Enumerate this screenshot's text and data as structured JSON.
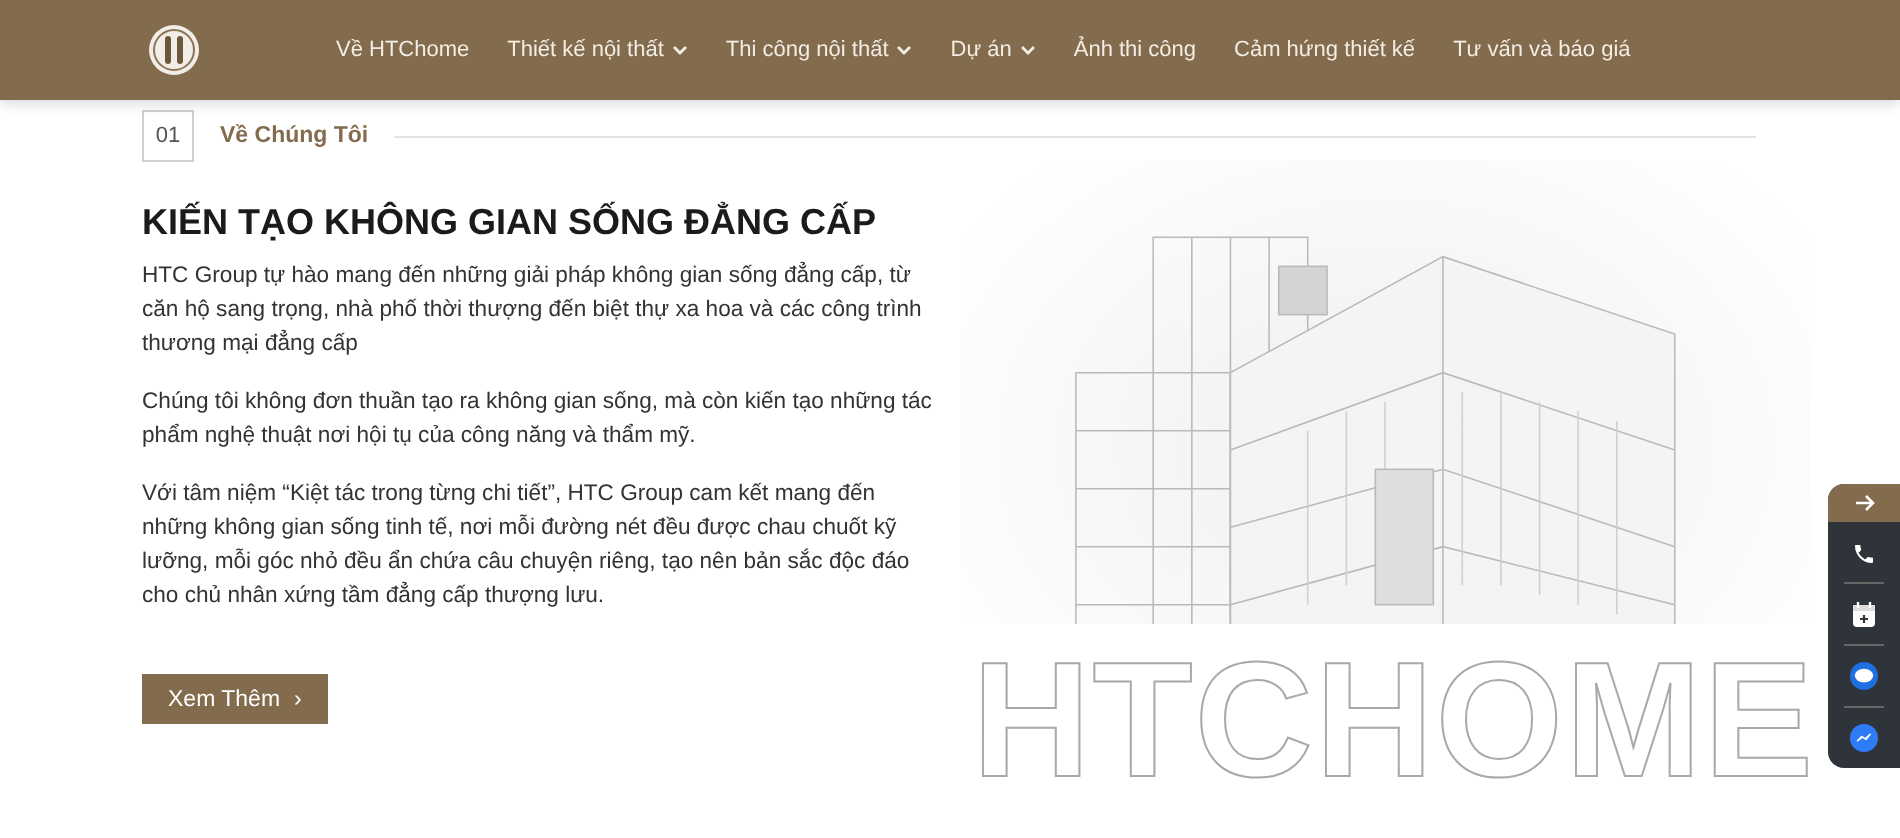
{
  "header": {
    "nav": [
      {
        "label": "Về HTChome",
        "has_dropdown": false
      },
      {
        "label": "Thiết kế nội thất",
        "has_dropdown": true
      },
      {
        "label": "Thi công nội thất",
        "has_dropdown": true
      },
      {
        "label": "Dự án",
        "has_dropdown": true
      },
      {
        "label": "Ảnh thi công",
        "has_dropdown": false
      },
      {
        "label": "Cảm hứng thiết kế",
        "has_dropdown": false
      },
      {
        "label": "Tư vấn và báo giá",
        "has_dropdown": false
      }
    ]
  },
  "section": {
    "number": "01",
    "label": "Về Chúng Tôi"
  },
  "heading": "KIẾN TẠO KHÔNG GIAN SỐNG ĐẲNG CẤP",
  "paragraphs": [
    "HTC Group tự hào mang đến những giải pháp không gian sống đẳng cấp, từ căn hộ sang trọng, nhà phố thời thượng đến biệt thự xa hoa và các công trình thương mại đẳng cấp",
    "Chúng tôi không đơn thuần tạo ra không gian sống, mà còn kiến tạo những tác phẩm nghệ thuật nơi hội tụ của công năng và thẩm mỹ.",
    "Với tâm niệm “Kiệt tác trong từng chi tiết”, HTC Group cam kết mang đến những không gian sống tinh tế, nơi mỗi đường nét đều được chau chuốt kỹ lưỡng, mỗi góc nhỏ đều ẩn chứa câu chuyện riêng, tạo nên bản sắc độc đáo cho chủ nhân xứng tầm đẳng cấp thượng lưu."
  ],
  "button": {
    "label": "Xem Thêm",
    "icon": "›"
  },
  "hero": {
    "outline_text": "HTCHOME"
  },
  "contact_bar": [
    {
      "kind": "arrow"
    },
    {
      "kind": "phone"
    },
    {
      "kind": "calendar"
    },
    {
      "kind": "zalo"
    },
    {
      "kind": "messenger"
    }
  ]
}
